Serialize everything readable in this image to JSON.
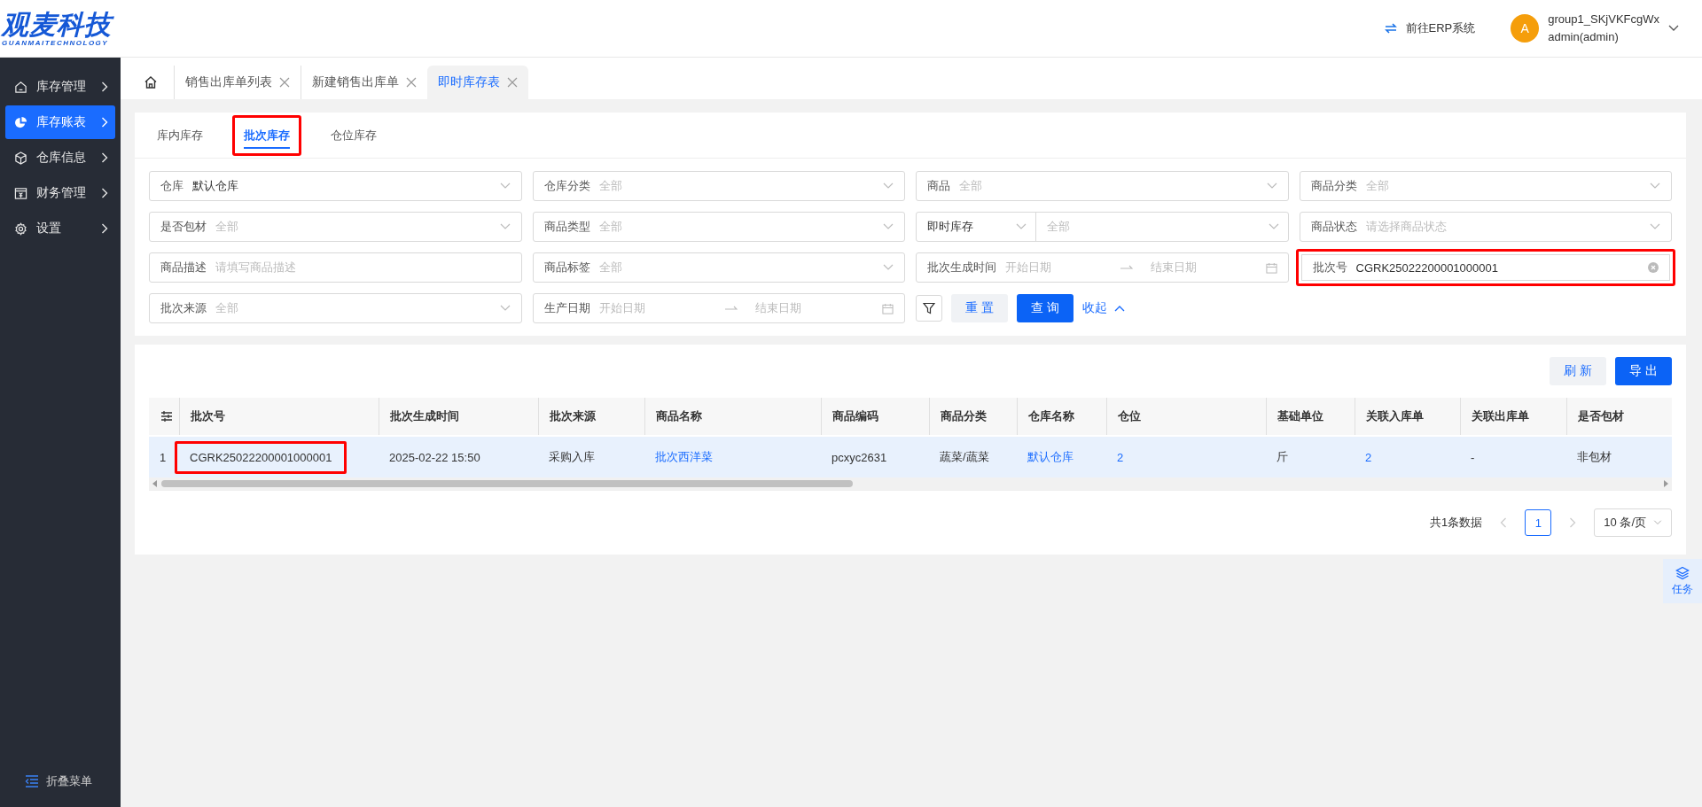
{
  "header": {
    "logo": {
      "name": "观麦科技",
      "sub": "GUANMAITECHNOLOGY"
    },
    "erp_link": "前往ERP系统",
    "user": {
      "avatar": "A",
      "name": "group1_SKjVKFcgWx",
      "role": "admin(admin)"
    }
  },
  "sidebar": {
    "items": [
      {
        "label": "库存管理",
        "kind": "home",
        "selected": false
      },
      {
        "label": "库存账表",
        "kind": "pie",
        "selected": true
      },
      {
        "label": "仓库信息",
        "kind": "cube",
        "selected": false
      },
      {
        "label": "财务管理",
        "kind": "money",
        "selected": false
      },
      {
        "label": "设置",
        "kind": "gear",
        "selected": false
      }
    ],
    "collapse": "折叠菜单"
  },
  "page_tabs": [
    {
      "label": "销售出库单列表",
      "selected": false
    },
    {
      "label": "新建销售出库单",
      "selected": false
    },
    {
      "label": "即时库存表",
      "selected": true
    }
  ],
  "sub_tabs": [
    {
      "label": "库内库存",
      "selected": false,
      "highlighted": false
    },
    {
      "label": "批次库存",
      "selected": true,
      "highlighted": true
    },
    {
      "label": "仓位库存",
      "selected": false,
      "highlighted": false
    }
  ],
  "filters": [
    {
      "kind": "select",
      "label": "仓库",
      "value": "默认仓库"
    },
    {
      "kind": "select",
      "label": "仓库分类",
      "placeholder": "全部"
    },
    {
      "kind": "select",
      "label": "商品",
      "placeholder": "全部"
    },
    {
      "kind": "select",
      "label": "商品分类",
      "placeholder": "全部"
    },
    {
      "kind": "select",
      "label": "是否包材",
      "placeholder": "全部"
    },
    {
      "kind": "select",
      "label": "商品类型",
      "placeholder": "全部"
    },
    {
      "kind": "select_pair",
      "value": "即时库存",
      "placeholder": "全部"
    },
    {
      "kind": "select",
      "label": "商品状态",
      "placeholder": "请选择商品状态"
    },
    {
      "kind": "input",
      "label": "商品描述",
      "placeholder": "请填写商品描述"
    },
    {
      "kind": "select",
      "label": "商品标签",
      "placeholder": "全部"
    },
    {
      "kind": "date_range",
      "label": "批次生成时间",
      "start_placeholder": "开始日期",
      "end_placeholder": "结束日期"
    },
    {
      "kind": "input",
      "label": "批次号",
      "value": "CGRK25022200001000001",
      "highlighted": true,
      "clearable": true
    },
    {
      "kind": "select",
      "label": "批次来源",
      "placeholder": "全部"
    },
    {
      "kind": "date_range",
      "label": "生产日期",
      "start_placeholder": "开始日期",
      "end_placeholder": "结束日期"
    }
  ],
  "filter_actions": {
    "reset": "重 置",
    "query": "查 询",
    "collapse": "收起"
  },
  "toolbar": {
    "refresh": "刷 新",
    "export": "导 出"
  },
  "table": {
    "columns": [
      "",
      "批次号",
      "批次生成时间",
      "批次来源",
      "商品名称",
      "商品编码",
      "商品分类",
      "仓库名称",
      "仓位",
      "基础单位",
      "关联入库单",
      "关联出库单",
      "是否包材"
    ],
    "rows": [
      {
        "cells": [
          {
            "text": "1",
            "kind": "text"
          },
          {
            "text": "CGRK25022200001000001",
            "kind": "text",
            "highlighted": true
          },
          {
            "text": "2025-02-22 15:50",
            "kind": "text"
          },
          {
            "text": "采购入库",
            "kind": "text"
          },
          {
            "text": "批次西洋菜",
            "kind": "link"
          },
          {
            "text": "pcxyc2631",
            "kind": "text"
          },
          {
            "text": "蔬菜/蔬菜",
            "kind": "text"
          },
          {
            "text": "默认仓库",
            "kind": "link"
          },
          {
            "text": "2",
            "kind": "link"
          },
          {
            "text": "斤",
            "kind": "text"
          },
          {
            "text": "2",
            "kind": "link"
          },
          {
            "text": "-",
            "kind": "text"
          },
          {
            "text": "非包材",
            "kind": "text"
          }
        ]
      }
    ]
  },
  "pagination": {
    "total": "共1条数据",
    "pages": [
      {
        "label": "1",
        "selected": true
      }
    ],
    "page_size": "10 条/页"
  },
  "task_button": "任务"
}
